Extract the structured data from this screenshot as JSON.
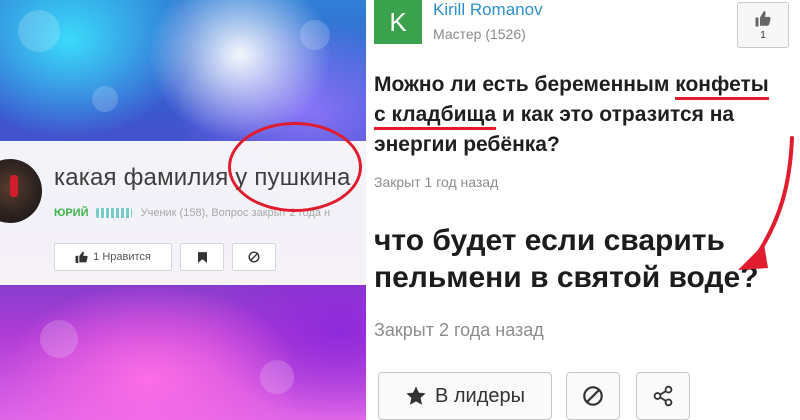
{
  "left": {
    "question_title": "какая фамилия у пушкина",
    "meta": {
      "user": "ЮРИЙ",
      "text": "Ученик (158), Вопрос закрыт 2 года н"
    },
    "actions": {
      "like_label": "1 Нравится"
    },
    "icons": {
      "like": "thumbs-up-icon",
      "bookmark": "bookmark-icon",
      "block": "block-icon"
    },
    "colors": {
      "highlight": "#e01c2e",
      "user": "#3bb54a"
    }
  },
  "right": {
    "author": {
      "initial": "K",
      "name": "Kirill Romanov",
      "rank": "Мастер (1526)"
    },
    "vote": {
      "count": "1",
      "icon": "thumbs-up-icon"
    },
    "question1": {
      "before": "Можно ли есть беременным ",
      "underlined": "конфеты с кладбища",
      "after": " и как это отразится на энергии ребёнка?"
    },
    "closed1": "Закрыт 1 год назад",
    "question2": "что будет если сварить пельмени в святой воде?",
    "closed2": "Закрыт 2 года назад",
    "buttons": {
      "leaders_label": "В лидеры",
      "leaders_icon": "star-icon",
      "block_icon": "block-icon",
      "share_icon": "share-icon"
    },
    "colors": {
      "author_link": "#2e8fc9",
      "avatar": "#3aa24c",
      "annotation": "#e01c2e"
    }
  }
}
